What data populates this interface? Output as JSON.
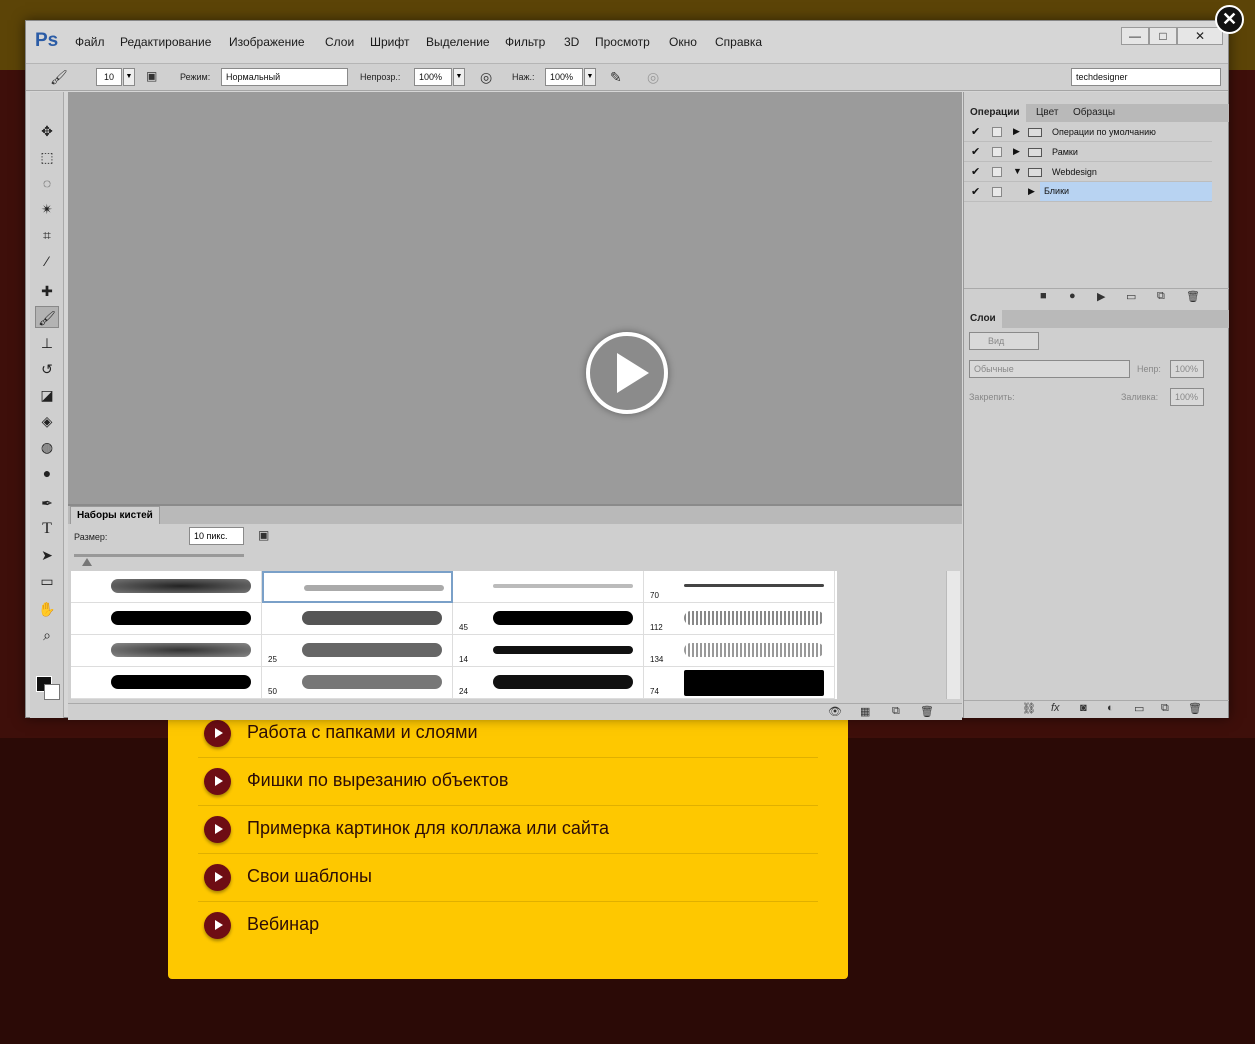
{
  "page": {
    "features": [
      "Работа с папками и слоями",
      "Фишки по вырезанию объектов",
      "Примерка картинок для коллажа или сайта",
      "Свои шаблоны",
      "Вебинар"
    ]
  },
  "window": {
    "logo": "Ps",
    "close_glyph": "✕",
    "menu": [
      "Файл",
      "Редактирование",
      "Изображение",
      "Слои",
      "Шрифт",
      "Выделение",
      "Фильтр",
      "3D",
      "Просмотр",
      "Окно",
      "Справка"
    ],
    "controls": {
      "minimize": "—",
      "maximize": "□",
      "close": "✕"
    }
  },
  "options": {
    "brush_size": "10",
    "mode_label": "Режим:",
    "mode_value": "Нормальный",
    "opacity_label": "Непрозр.:",
    "opacity_value": "100%",
    "flow_label": "Наж.:",
    "flow_value": "100%",
    "workspace": "techdesigner"
  },
  "brush_panel": {
    "tab": "Наборы кистей",
    "size_label": "Размер:",
    "size_value": "10 пикс.",
    "numbers": [
      "70",
      "45",
      "112",
      "25",
      "14",
      "134",
      "50",
      "24",
      "74"
    ]
  },
  "actions_panel": {
    "tabs": [
      "Операции",
      "Цвет",
      "Образцы"
    ],
    "rows": [
      "Операции по умолчанию",
      "Рамки",
      "Webdesign",
      "Блики"
    ]
  },
  "layers_panel": {
    "tab": "Слои",
    "filter": "Вид",
    "blend": "Обычные",
    "opacity_label": "Непр:",
    "opacity_value": "100%",
    "lock_label": "Закрепить:",
    "fill_label": "Заливка:",
    "fill_value": "100%"
  },
  "colors": {
    "accent": "#fec800",
    "bullet": "#6e0d14",
    "selection": "#b8d3f2"
  }
}
